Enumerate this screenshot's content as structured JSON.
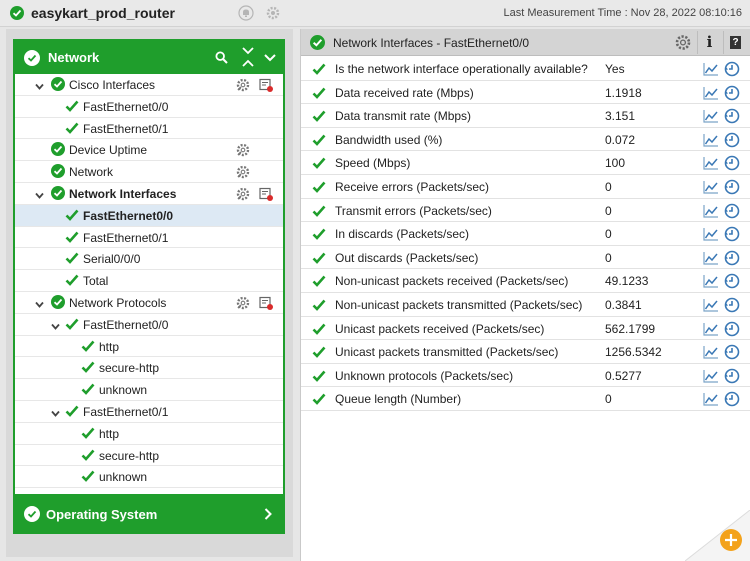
{
  "header": {
    "host": "easykart_prod_router",
    "last_measurement_label": "Last Measurement Time : Nov 28, 2022 08:10:16"
  },
  "colors": {
    "ok_green": "#1f9e2c",
    "selected_row": "#dde9f4",
    "icon_blue": "#3a78b5"
  },
  "tree": {
    "title": "Network",
    "rows": [
      {
        "label": "Cisco Interfaces",
        "level": 1,
        "expanded": true,
        "status": "circle",
        "bold": false,
        "gear": true,
        "report": true
      },
      {
        "label": "FastEthernet0/0",
        "level": 2,
        "status": "tick"
      },
      {
        "label": "FastEthernet0/1",
        "level": 2,
        "status": "tick"
      },
      {
        "label": "Device Uptime",
        "level": 1,
        "status": "circle",
        "gear": true
      },
      {
        "label": "Network",
        "level": 1,
        "status": "circle",
        "gear": true
      },
      {
        "label": "Network Interfaces",
        "level": 1,
        "expanded": true,
        "status": "circle",
        "bold": true,
        "gear": true,
        "report": true
      },
      {
        "label": "FastEthernet0/0",
        "level": 2,
        "status": "tick",
        "bold": true,
        "selected": true
      },
      {
        "label": "FastEthernet0/1",
        "level": 2,
        "status": "tick"
      },
      {
        "label": "Serial0/0/0",
        "level": 2,
        "status": "tick"
      },
      {
        "label": "Total",
        "level": 2,
        "status": "tick"
      },
      {
        "label": "Network Protocols",
        "level": 1,
        "expanded": true,
        "status": "circle",
        "gear": true,
        "report": true
      },
      {
        "label": "FastEthernet0/0",
        "level": 2,
        "expanded": true,
        "status": "tick"
      },
      {
        "label": "http",
        "level": 3,
        "status": "tick"
      },
      {
        "label": "secure-http",
        "level": 3,
        "status": "tick"
      },
      {
        "label": "unknown",
        "level": 3,
        "status": "tick"
      },
      {
        "label": "FastEthernet0/1",
        "level": 2,
        "expanded": true,
        "status": "tick"
      },
      {
        "label": "http",
        "level": 3,
        "status": "tick"
      },
      {
        "label": "secure-http",
        "level": 3,
        "status": "tick"
      },
      {
        "label": "unknown",
        "level": 3,
        "status": "tick"
      }
    ]
  },
  "os_section": {
    "title": "Operating System"
  },
  "details": {
    "title": "Network Interfaces - FastEthernet0/0",
    "info_label": "i",
    "help_label": "?",
    "rows": [
      {
        "label": "Is the network interface operationally available?",
        "value": "Yes"
      },
      {
        "label": "Data received rate (Mbps)",
        "value": "1.1918"
      },
      {
        "label": "Data transmit rate (Mbps)",
        "value": "3.151"
      },
      {
        "label": "Bandwidth used (%)",
        "value": "0.072"
      },
      {
        "label": "Speed (Mbps)",
        "value": "100"
      },
      {
        "label": "Receive errors (Packets/sec)",
        "value": "0"
      },
      {
        "label": "Transmit errors (Packets/sec)",
        "value": "0"
      },
      {
        "label": "In discards (Packets/sec)",
        "value": "0"
      },
      {
        "label": "Out discards (Packets/sec)",
        "value": "0"
      },
      {
        "label": "Non-unicast packets received (Packets/sec)",
        "value": "49.1233"
      },
      {
        "label": "Non-unicast packets transmitted (Packets/sec)",
        "value": "0.3841"
      },
      {
        "label": "Unicast packets received (Packets/sec)",
        "value": "562.1799"
      },
      {
        "label": "Unicast packets transmitted (Packets/sec)",
        "value": "1256.5342"
      },
      {
        "label": "Unknown protocols (Packets/sec)",
        "value": "0.5277"
      },
      {
        "label": "Queue length (Number)",
        "value": "0"
      }
    ]
  }
}
